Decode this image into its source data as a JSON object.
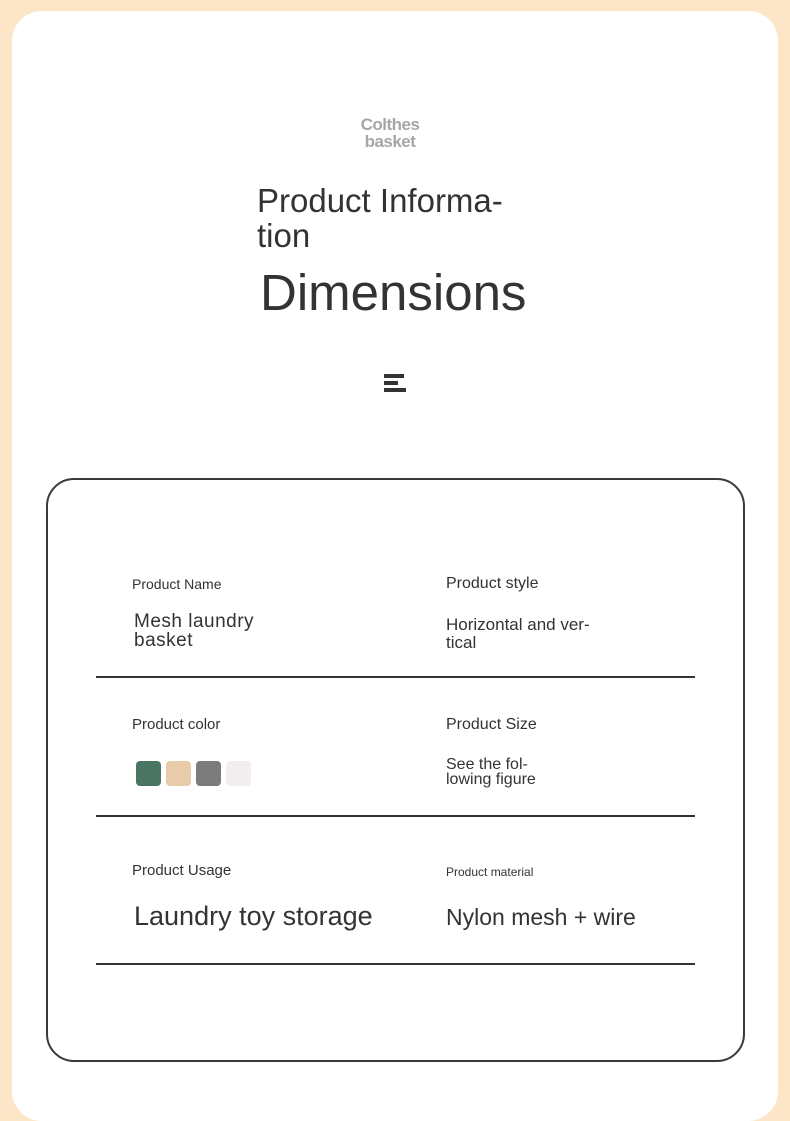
{
  "header": {
    "brand_line1": "Colthes",
    "brand_line2": "basket",
    "title_line1": "Product Informa-",
    "title_line2": "tion",
    "subtitle": "Dimensions",
    "icon": "menu-icon"
  },
  "specs": {
    "name_label": "Product Name",
    "name_value_line1": "Mesh laundry",
    "name_value_line2": "basket",
    "style_label": "Product style",
    "style_value_line1": "Horizontal and ver-",
    "style_value_line2": "tical",
    "color_label": "Product color",
    "colors": [
      "#4a7563",
      "#e8ccaa",
      "#7c7c7c",
      "#f2edef"
    ],
    "size_label": "Product Size",
    "size_value_line1": "See the fol-",
    "size_value_line2": "lowing figure",
    "usage_label": "Product Usage",
    "usage_value": "Laundry toy storage",
    "material_label": "Product material",
    "material_value": "Nylon mesh + wire"
  }
}
